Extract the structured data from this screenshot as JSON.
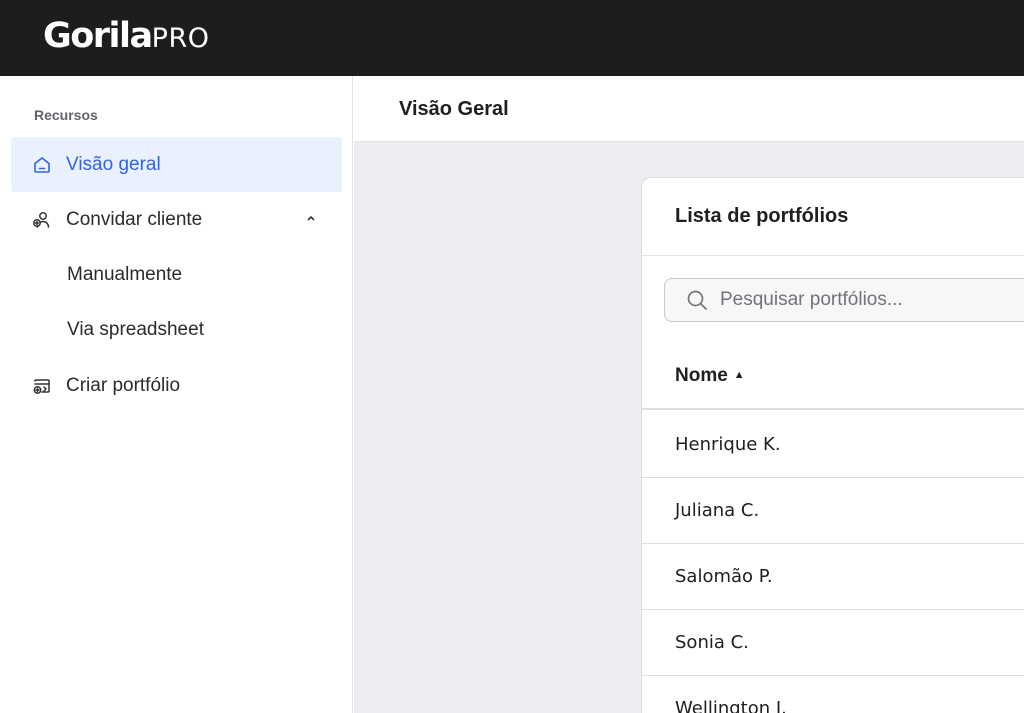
{
  "app": {
    "brand": "Gorila",
    "brand_suffix": "PRO"
  },
  "sidebar": {
    "section_label": "Recursos",
    "items": [
      {
        "label": "Visão geral",
        "icon": "home-icon",
        "active": true
      },
      {
        "label": "Convidar cliente",
        "icon": "invite-user-icon",
        "expanded": true
      },
      {
        "label": "Manualmente",
        "sub": true
      },
      {
        "label": "Via spreadsheet",
        "sub": true
      },
      {
        "label": "Criar portfólio",
        "icon": "create-portfolio-icon"
      }
    ]
  },
  "header": {
    "title": "Visão Geral"
  },
  "card": {
    "title": "Lista de portfólios",
    "search": {
      "placeholder": "Pesquisar portfólios...",
      "value": ""
    },
    "table": {
      "column": "Nome",
      "sort_indicator": "▲",
      "rows": [
        "Henrique K.",
        "Juliana C.",
        "Salomão P.",
        "Sonia C.",
        "Wellington I."
      ]
    }
  },
  "colors": {
    "accent": "#2f63e8",
    "active_bg": "#e9f0fe",
    "topbar": "#1d1d1f",
    "main_bg": "#ecedf1"
  }
}
